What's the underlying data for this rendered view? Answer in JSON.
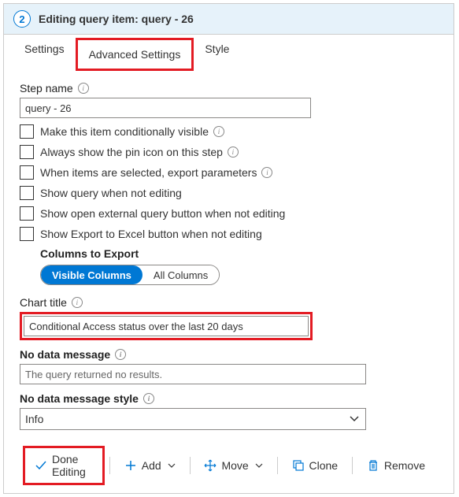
{
  "header": {
    "step_number": "2",
    "title": "Editing query item: query - 26"
  },
  "tabs": {
    "settings": "Settings",
    "advanced": "Advanced Settings",
    "style": "Style"
  },
  "form": {
    "step_name_label": "Step name",
    "step_name_value": "query - 26",
    "chk_conditional": "Make this item conditionally visible",
    "chk_pin": "Always show the pin icon on this step",
    "chk_export_params": "When items are selected, export parameters",
    "chk_show_query": "Show query when not editing",
    "chk_open_external": "Show open external query button when not editing",
    "chk_export_excel": "Show Export to Excel button when not editing",
    "columns_heading": "Columns to Export",
    "pill_visible": "Visible Columns",
    "pill_all": "All Columns",
    "chart_title_label": "Chart title",
    "chart_title_value": "Conditional Access status over the last 20 days",
    "no_data_label": "No data message",
    "no_data_placeholder": "The query returned no results.",
    "no_data_style_label": "No data message style",
    "no_data_style_value": "Info"
  },
  "toolbar": {
    "done": "Done Editing",
    "add": "Add",
    "move": "Move",
    "clone": "Clone",
    "remove": "Remove"
  }
}
